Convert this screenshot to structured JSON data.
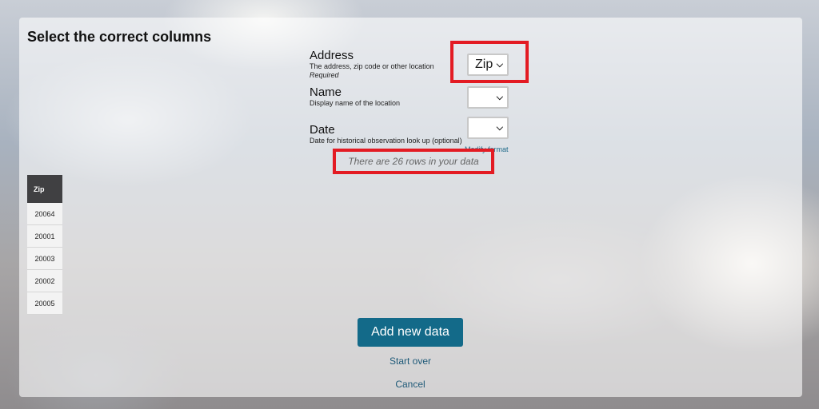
{
  "page_title": "Select the correct columns",
  "columns": {
    "address": {
      "label": "Address",
      "description": "The address, zip code or other location",
      "required": "Required",
      "selected": "Zip"
    },
    "name": {
      "label": "Name",
      "description": "Display name of the location",
      "selected": ""
    },
    "date": {
      "label": "Date",
      "description": "Date for historical observation look up (optional)",
      "selected": "",
      "modify_link": "Modify format"
    }
  },
  "row_count_text": "There are 26 rows in your data",
  "table": {
    "header": "Zip",
    "rows": [
      "20064",
      "20001",
      "20003",
      "20002",
      "20005"
    ]
  },
  "buttons": {
    "add_new_data": "Add new data",
    "start_over": "Start over",
    "cancel": "Cancel"
  },
  "icons": {
    "dropdown": "chevron-down-icon"
  },
  "colors": {
    "primary_button": "#136a89",
    "highlight": "#e31b23",
    "table_header": "#404042"
  }
}
